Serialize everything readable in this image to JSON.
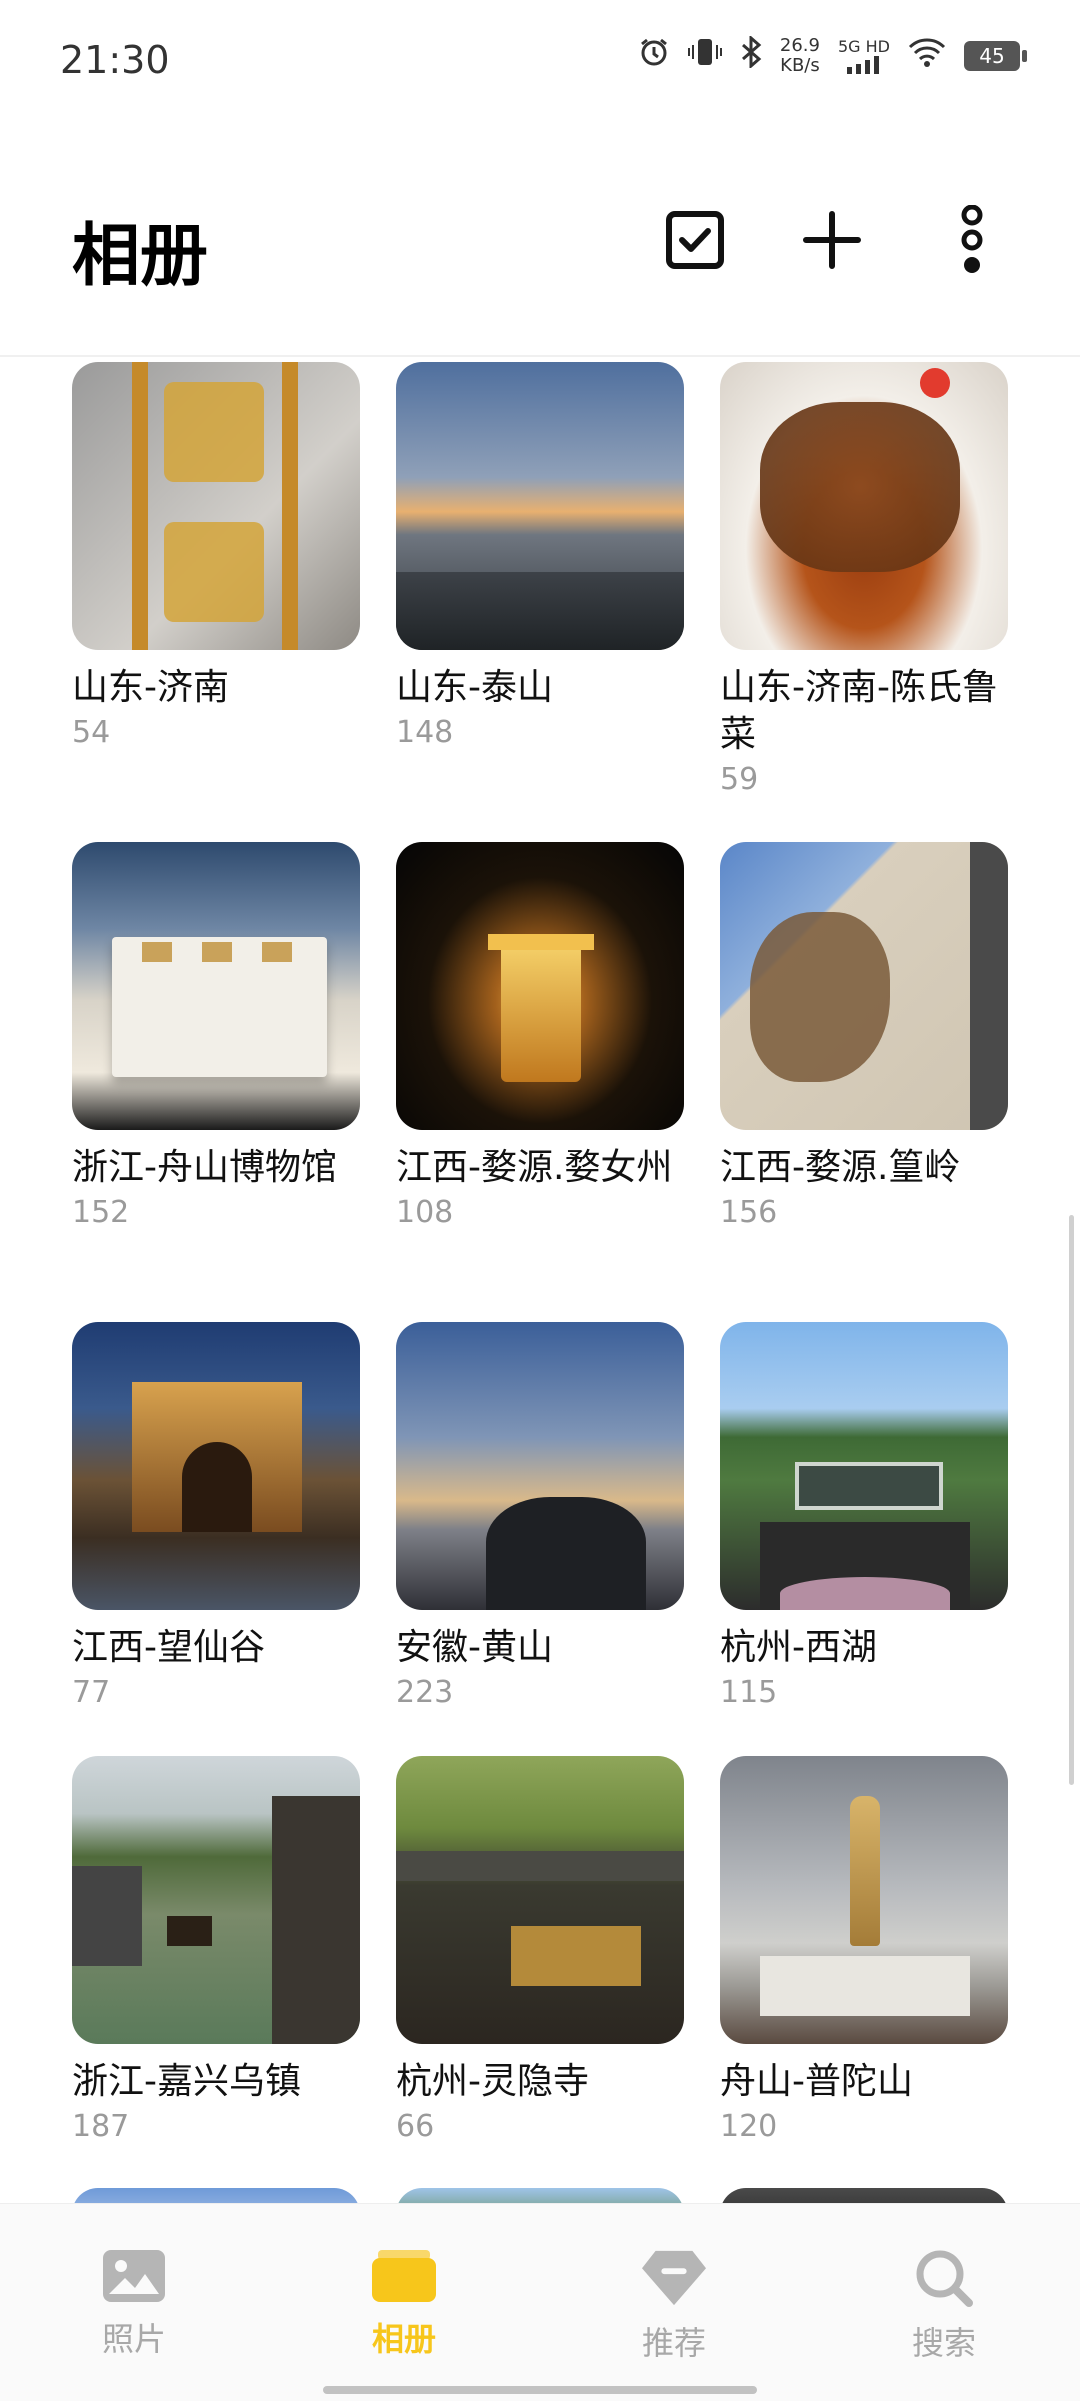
{
  "status_bar": {
    "time": "21:30",
    "net_speed_value": "26.9",
    "net_speed_unit": "KB/s",
    "network_label": "5G HD",
    "battery": "45"
  },
  "header": {
    "title": "相册",
    "icons": [
      "select-checkbox-icon",
      "add-icon",
      "more-vertical-icon"
    ]
  },
  "albums": [
    {
      "name": "山东-济南",
      "count": "54"
    },
    {
      "name": "山东-泰山",
      "count": "148"
    },
    {
      "name": "山东-济南-陈氏鲁菜",
      "count": "59"
    },
    {
      "name": "浙江-舟山博物馆",
      "count": "152"
    },
    {
      "name": "江西-婺源.婺女州",
      "count": "108"
    },
    {
      "name": "江西-婺源.篁岭",
      "count": "156"
    },
    {
      "name": "江西-望仙谷",
      "count": "77"
    },
    {
      "name": "安徽-黄山",
      "count": "223"
    },
    {
      "name": "杭州-西湖",
      "count": "115"
    },
    {
      "name": "浙江-嘉兴乌镇",
      "count": "187"
    },
    {
      "name": "杭州-灵隐寺",
      "count": "66"
    },
    {
      "name": "舟山-普陀山",
      "count": "120"
    }
  ],
  "bottom_nav": [
    {
      "label": "照片",
      "icon": "photo-icon",
      "active": false
    },
    {
      "label": "相册",
      "icon": "album-icon",
      "active": true
    },
    {
      "label": "推荐",
      "icon": "recommend-icon",
      "active": false
    },
    {
      "label": "搜索",
      "icon": "search-icon",
      "active": false
    }
  ],
  "colors": {
    "accent": "#f7c61b",
    "inactive": "#a8a8a8",
    "count_text": "#9a9a9a"
  }
}
